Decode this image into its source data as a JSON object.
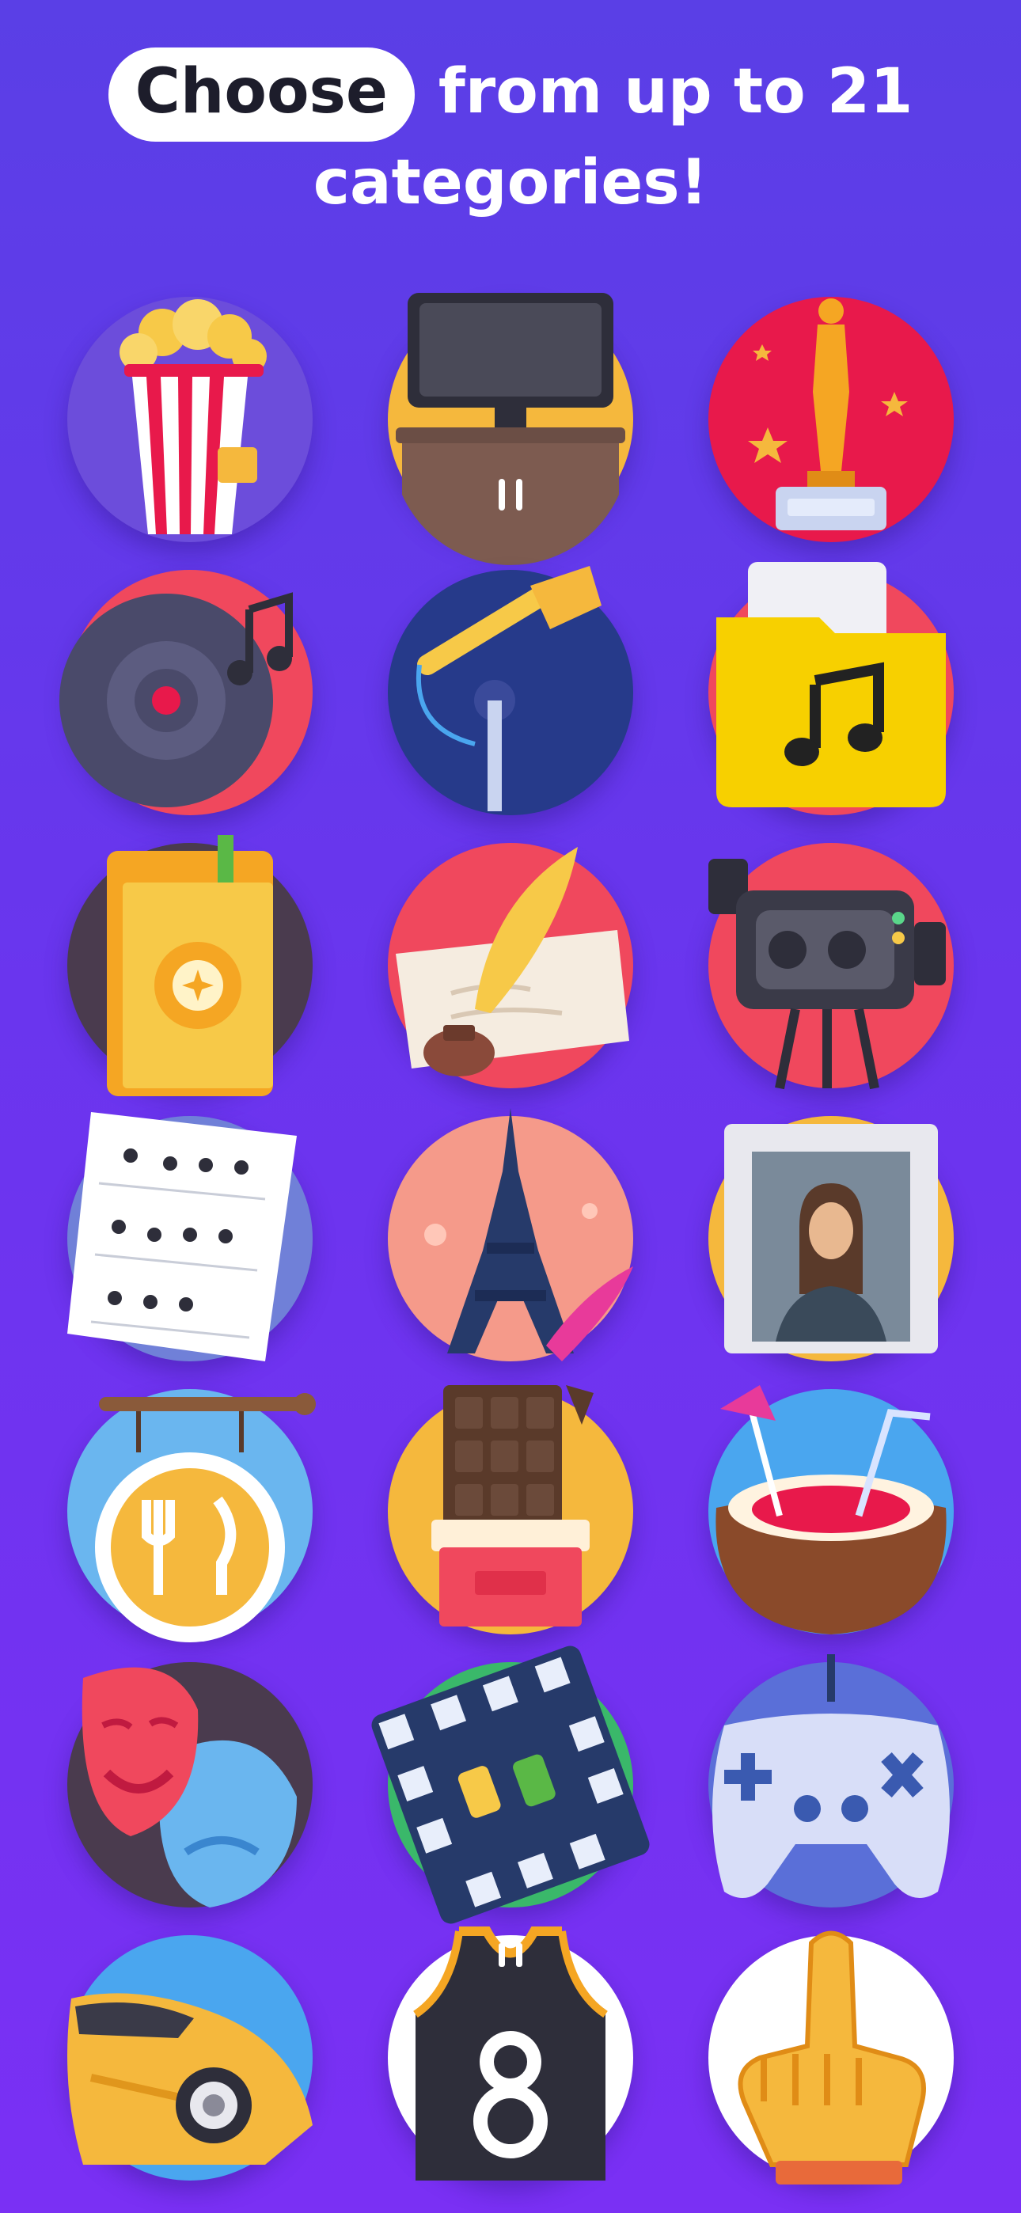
{
  "headline": {
    "highlight": "Choose",
    "line1_rest": "from up to 21",
    "line2": "categories!"
  },
  "categories": [
    {
      "icon": "popcorn-icon",
      "bg": "#6c4ddb"
    },
    {
      "icon": "television-icon",
      "bg": "#f5b83d"
    },
    {
      "icon": "oscar-trophy-icon",
      "bg": "#e8194b"
    },
    {
      "icon": "vinyl-record-icon",
      "bg": "#f0485d"
    },
    {
      "icon": "microphone-icon",
      "bg": "#263a8a"
    },
    {
      "icon": "music-folder-icon",
      "bg": "#f0485d"
    },
    {
      "icon": "book-icon",
      "bg": "#4a3b4e"
    },
    {
      "icon": "quill-scroll-icon",
      "bg": "#f0485d"
    },
    {
      "icon": "video-camera-icon",
      "bg": "#f0485d"
    },
    {
      "icon": "sheet-music-icon",
      "bg": "#7080d8"
    },
    {
      "icon": "eiffel-tower-icon",
      "bg": "#f59a8a"
    },
    {
      "icon": "portrait-painting-icon",
      "bg": "#f5b83d"
    },
    {
      "icon": "restaurant-sign-icon",
      "bg": "#6ab6ef"
    },
    {
      "icon": "chocolate-bar-icon",
      "bg": "#f5b83d"
    },
    {
      "icon": "coconut-drink-icon",
      "bg": "#4aa6ef"
    },
    {
      "icon": "theater-masks-icon",
      "bg": "#4a3b4e"
    },
    {
      "icon": "board-game-icon",
      "bg": "#3ab86a"
    },
    {
      "icon": "game-controller-icon",
      "bg": "#5a6fd8"
    },
    {
      "icon": "race-car-icon",
      "bg": "#4aa6ef"
    },
    {
      "icon": "basketball-jersey-icon",
      "bg": "#ffffff"
    },
    {
      "icon": "foam-finger-icon",
      "bg": "#ffffff"
    }
  ]
}
